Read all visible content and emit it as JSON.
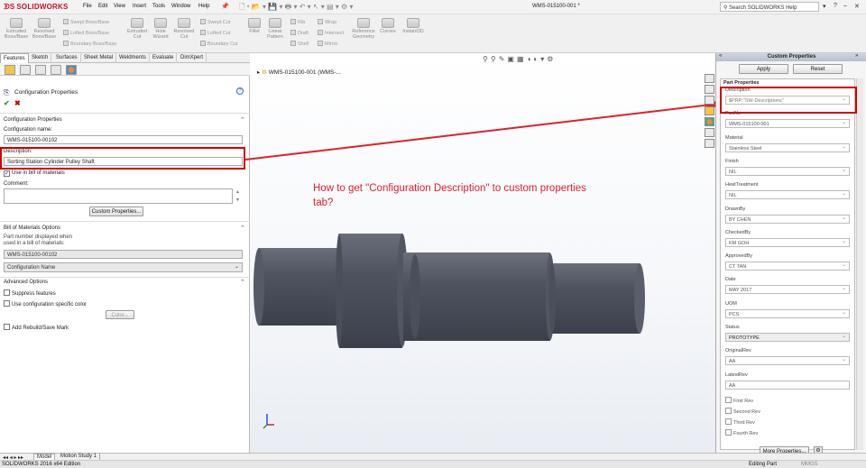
{
  "app": {
    "brand": "SOLIDWORKS",
    "doc_title": "WMS-015100-001 *",
    "search_placeholder": "Search SOLIDWORKS Help"
  },
  "menu": [
    "File",
    "Edit",
    "View",
    "Insert",
    "Tools",
    "Window",
    "Help"
  ],
  "ribbon": {
    "extruded_boss": "Extruded\nBoss/Base",
    "revolved_boss": "Revolved\nBoss/Base",
    "swept_boss": "Swept Boss/Base",
    "lofted_boss": "Lofted Boss/Base",
    "boundary_boss": "Boundary Boss/Base",
    "extruded_cut": "Extruded\nCut",
    "hole_wizard": "Hole\nWizard",
    "revolved_cut": "Revolved\nCut",
    "swept_cut": "Swept Cut",
    "lofted_cut": "Lofted Cut",
    "boundary_cut": "Boundary Cut",
    "fillet": "Fillet",
    "linear_pattern": "Linear\nPattern",
    "rib": "Rib",
    "draft": "Draft",
    "shell": "Shell",
    "wrap": "Wrap",
    "intersect": "Intersect",
    "mirror": "Mirror",
    "ref_geometry": "Reference\nGeometry",
    "curves": "Curves",
    "instant3d": "Instant3D"
  },
  "cmd_tabs": [
    "Features",
    "Sketch",
    "Surfaces",
    "Sheet Metal",
    "Weldments",
    "Evaluate",
    "DimXpert"
  ],
  "left": {
    "title": "Configuration Properties",
    "sec_config": "Configuration Properties",
    "config_name_label": "Configuration name:",
    "config_name": "WMS-015100-00102",
    "description_label": "Description:",
    "description": "Sorting Station Cylinder Pulley Shaft",
    "use_bom": "Use in bill of materials",
    "comment_label": "Comment:",
    "custom_props_btn": "Custom Properties...",
    "sec_bom": "Bill of Materials Options",
    "part_number_label_1": "Part number displayed when",
    "part_number_label_2": "used in a bill of materials:",
    "part_number": "WMS-015100-00102",
    "bom_option": "Configuration Name",
    "sec_advanced": "Advanced Options",
    "suppress": "Suppress features",
    "use_color": "Use configuration specific color",
    "color_btn": "Color...",
    "rebuild": "Add Rebuild/Save Mark"
  },
  "viewport": {
    "tree_item": "WMS-015100-001  (WMS-...",
    "question_line1": "How to get \"Configuration Description\" to custom properties",
    "question_line2": "tab?"
  },
  "right": {
    "header": "Custom Properties",
    "apply": "Apply",
    "reset": "Reset",
    "section": "Part Properties",
    "fields": [
      {
        "label": "Description",
        "value": "$PRP:\"SW-Descriptions\""
      },
      {
        "label": "PartNo",
        "value": "WMS-015100-001"
      },
      {
        "label": "Material",
        "value": "Stainless Steel"
      },
      {
        "label": "Finish",
        "value": "NIL"
      },
      {
        "label": "HeatTreatment",
        "value": "NIL"
      },
      {
        "label": "DrawnBy",
        "value": "BY CHEN"
      },
      {
        "label": "CheckedBy",
        "value": "KM GOH"
      },
      {
        "label": "ApprovedBy",
        "value": "CT TAN"
      },
      {
        "label": "Date",
        "value": "MAY 2017"
      },
      {
        "label": "UOM",
        "value": "PCS"
      },
      {
        "label": "Status",
        "value": "PROTOTYPE"
      },
      {
        "label": "OriginalRev",
        "value": "AA"
      },
      {
        "label": "LatestRev",
        "value": "AA"
      }
    ],
    "revs": [
      "First Rev",
      "Second Rev",
      "Third Rev",
      "Fourth Rev"
    ],
    "more_props": "More Properties..."
  },
  "bottom": {
    "tab_model": "Model",
    "tab_motion": "Motion Study 1",
    "edition": "SOLIDWORKS 2016 x64 Edition",
    "mode": "Editing Part",
    "units": "MMGS"
  },
  "colors": {
    "brand_red": "#c8102e",
    "annotation_red": "#e0202a",
    "box_red": "#d00000",
    "shaft": "#4a4e5a"
  }
}
